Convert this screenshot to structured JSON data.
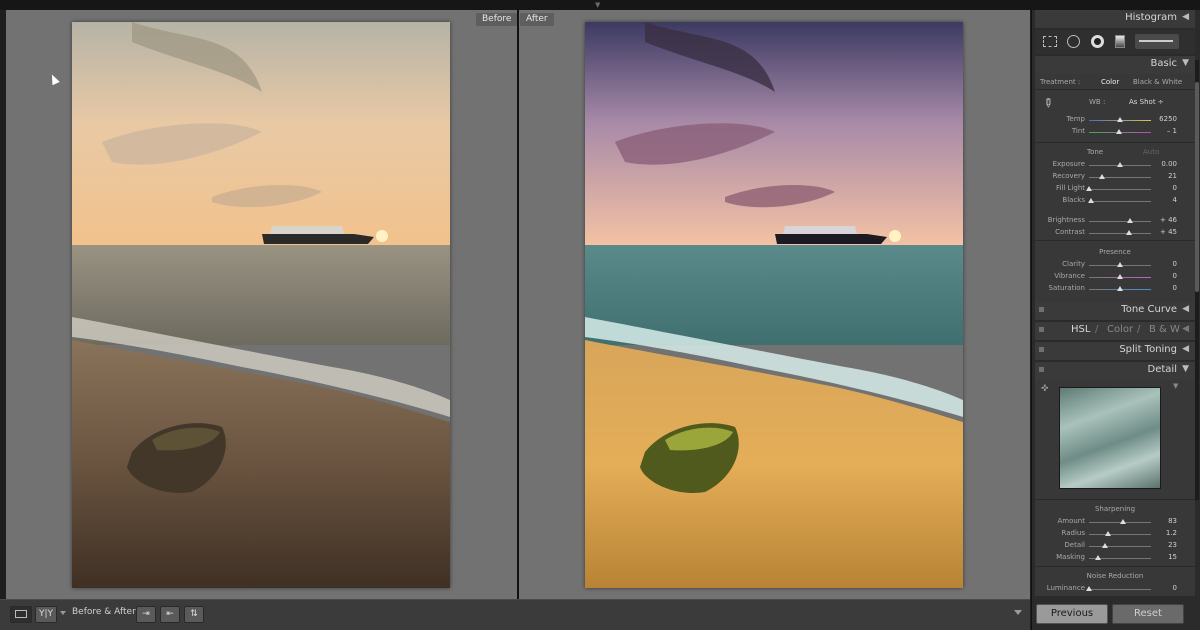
{
  "view": {
    "before_label": "Before",
    "after_label": "After"
  },
  "toolbar": {
    "view_mode_icon": "loupe-view-icon",
    "yy_label": "Y|Y",
    "before_after_label": "Before & After :",
    "swap_icons": [
      "copy-before-to-after-icon",
      "copy-after-to-before-icon",
      "swap-settings-icon"
    ]
  },
  "panel": {
    "histogram_title": "Histogram",
    "tools": [
      "crop-overlay-icon",
      "spot-removal-icon",
      "red-eye-icon",
      "graduated-filter-icon",
      "adjustment-brush-icon"
    ],
    "basic": {
      "title": "Basic",
      "treatment_label": "Treatment :",
      "color_option": "Color",
      "bw_option": "Black & White",
      "wb_label": "WB :",
      "wb_value": "As Shot ÷",
      "temp_label": "Temp",
      "temp_value": "6250",
      "temp_pos": 0.5,
      "tint_label": "Tint",
      "tint_value": "– 1",
      "tint_pos": 0.49,
      "tone_label": "Tone",
      "auto_label": "Auto",
      "exposure_label": "Exposure",
      "exposure_value": "0.00",
      "exposure_pos": 0.5,
      "recovery_label": "Recovery",
      "recovery_value": "21",
      "recovery_pos": 0.21,
      "filllight_label": "Fill Light",
      "filllight_value": "0",
      "filllight_pos": 0.0,
      "blacks_label": "Blacks",
      "blacks_value": "4",
      "blacks_pos": 0.04,
      "brightness_label": "Brightness",
      "brightness_value": "+ 46",
      "brightness_pos": 0.66,
      "contrast_label": "Contrast",
      "contrast_value": "+ 45",
      "contrast_pos": 0.64,
      "presence_label": "Presence",
      "clarity_label": "Clarity",
      "clarity_value": "0",
      "clarity_pos": 0.5,
      "vibrance_label": "Vibrance",
      "vibrance_value": "0",
      "vibrance_pos": 0.5,
      "saturation_label": "Saturation",
      "saturation_value": "0",
      "saturation_pos": 0.5
    },
    "tone_curve_title": "Tone Curve",
    "hsl": {
      "hsl": "HSL",
      "sep": "/",
      "color": "Color",
      "bw": "B & W"
    },
    "split_toning_title": "Split Toning",
    "detail": {
      "title": "Detail",
      "sharpening_label": "Sharpening",
      "amount_label": "Amount",
      "amount_value": "83",
      "amount_pos": 0.55,
      "radius_label": "Radius",
      "radius_value": "1.2",
      "radius_pos": 0.3,
      "detail_label": "Detail",
      "detail_value": "23",
      "detail_pos": 0.25,
      "masking_label": "Masking",
      "masking_value": "15",
      "masking_pos": 0.15,
      "noise_label": "Noise Reduction",
      "luminance_label": "Luminance",
      "luminance_value": "0",
      "luminance_pos": 0.0
    },
    "previous_label": "Previous",
    "reset_label": "Reset"
  },
  "colors": {
    "panel_bg": "#383838",
    "header_bg": "#3a3a3a",
    "view_bg": "#727272"
  }
}
